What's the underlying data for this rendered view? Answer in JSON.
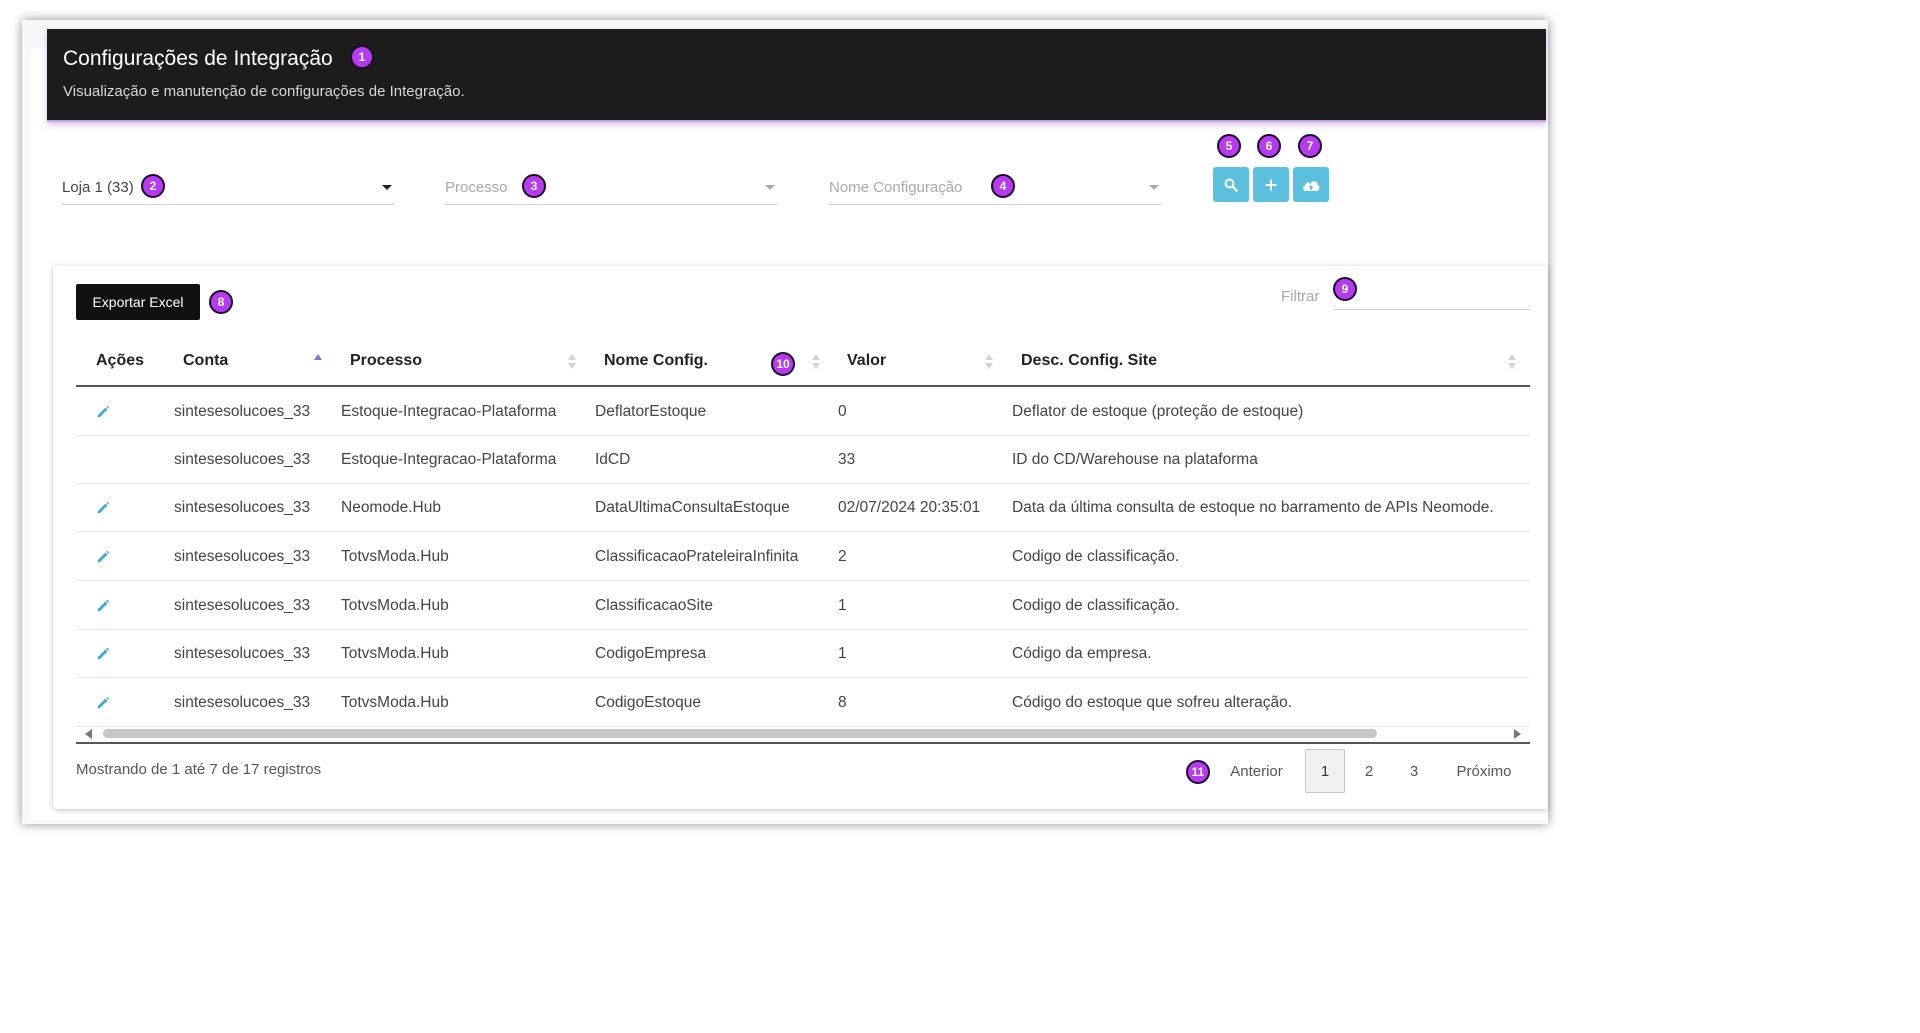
{
  "header": {
    "title": "Configurações de Integração",
    "subtitle": "Visualização e manutenção de configurações de Integração."
  },
  "filters": {
    "loja": {
      "value": "Loja 1 (33)"
    },
    "processo": {
      "placeholder": "Processo"
    },
    "nome_config": {
      "placeholder": "Nome Configuração"
    }
  },
  "toolbar": {
    "search_icon": "search-icon",
    "add_icon": "plus-icon",
    "upload_icon": "cloud-upload-icon"
  },
  "accent_color": "#5bc0de",
  "badge_color": "#b63bf0",
  "badges": [
    "1",
    "2",
    "3",
    "4",
    "5",
    "6",
    "7",
    "8",
    "9",
    "10",
    "11"
  ],
  "table": {
    "export_label": "Exportar Excel",
    "filter_label": "Filtrar",
    "filter_value": "",
    "columns": [
      "Ações",
      "Conta",
      "Processo",
      "Nome Config.",
      "Valor",
      "Desc. Config. Site"
    ],
    "rows": [
      {
        "editable": true,
        "conta": "sintesesolucoes_33",
        "processo": "Estoque-Integracao-Plataforma",
        "nome": "DeflatorEstoque",
        "valor": "0",
        "desc": "Deflator de estoque (proteção de estoque)"
      },
      {
        "editable": false,
        "conta": "sintesesolucoes_33",
        "processo": "Estoque-Integracao-Plataforma",
        "nome": "IdCD",
        "valor": "33",
        "desc": "ID do CD/Warehouse na plataforma"
      },
      {
        "editable": true,
        "conta": "sintesesolucoes_33",
        "processo": "Neomode.Hub",
        "nome": "DataUltimaConsultaEstoque",
        "valor": "02/07/2024 20:35:01",
        "desc": "Data da última consulta de estoque no barramento de APIs Neomode."
      },
      {
        "editable": true,
        "conta": "sintesesolucoes_33",
        "processo": "TotvsModa.Hub",
        "nome": "ClassificacaoPrateleiraInfinita",
        "valor": "2",
        "desc": "Codigo de classificação."
      },
      {
        "editable": true,
        "conta": "sintesesolucoes_33",
        "processo": "TotvsModa.Hub",
        "nome": "ClassificacaoSite",
        "valor": "1",
        "desc": "Codigo de classificação."
      },
      {
        "editable": true,
        "conta": "sintesesolucoes_33",
        "processo": "TotvsModa.Hub",
        "nome": "CodigoEmpresa",
        "valor": "1",
        "desc": "Código da empresa."
      },
      {
        "editable": true,
        "conta": "sintesesolucoes_33",
        "processo": "TotvsModa.Hub",
        "nome": "CodigoEstoque",
        "valor": "8",
        "desc": "Código do estoque que sofreu alteração."
      }
    ],
    "info": "Mostrando de 1 até 7 de 17 registros",
    "pagination": {
      "prev": "Anterior",
      "pages": [
        "1",
        "2",
        "3"
      ],
      "current": "1",
      "next": "Próximo"
    }
  }
}
